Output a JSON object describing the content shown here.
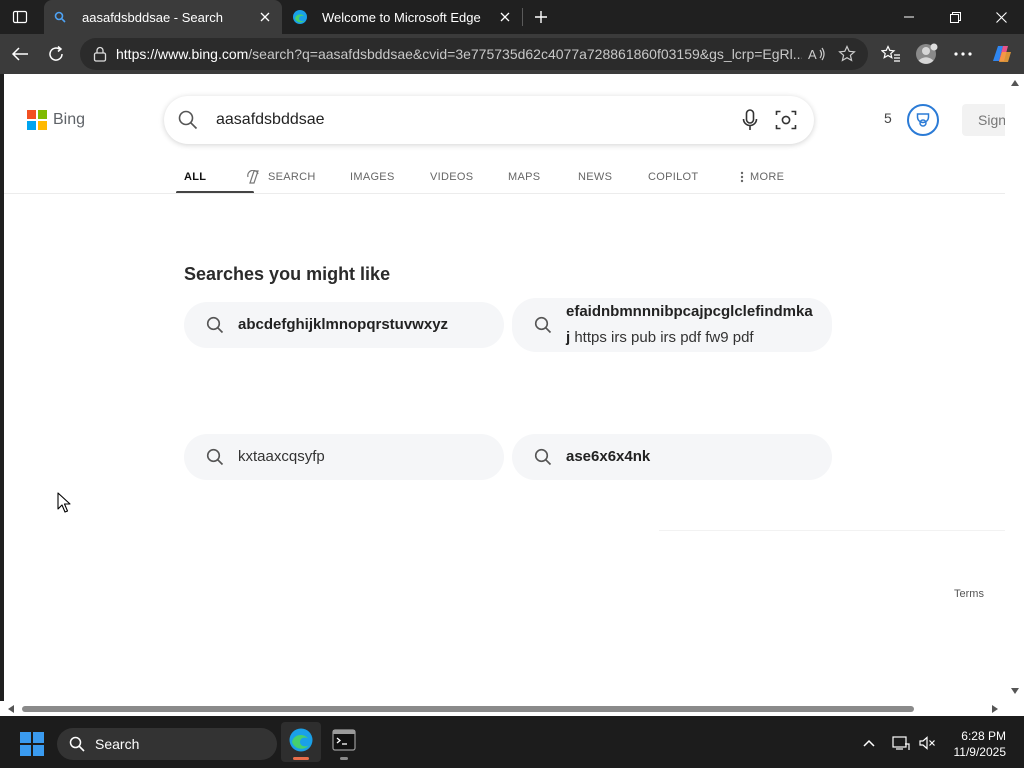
{
  "browser": {
    "tabs": [
      {
        "title": "aasafdsbddsae - Search",
        "active": true
      },
      {
        "title": "Welcome to Microsoft Edge",
        "active": false
      }
    ],
    "url_host": "https://www.bing.com",
    "url_rest": "/search?q=aasafdsbddsae&cvid=3e775735d62c4077a728861860f03159&gs_lcrp=EgRl..."
  },
  "page": {
    "logo_text": "Bing",
    "query": "aasafdsbddsae",
    "rewards_count": "5",
    "signin_label": "Sign in",
    "scopes": [
      "ALL",
      "SEARCH",
      "IMAGES",
      "VIDEOS",
      "MAPS",
      "NEWS",
      "COPILOT",
      "MORE"
    ],
    "related_heading": "Searches you might like",
    "related": [
      {
        "bold": "abcdefghijklmnopqrstuvwxyz",
        "rest": ""
      },
      {
        "bold": "efaidnbmnnnibpcajpcglclefindmkaj",
        "rest": " https irs pub irs pdf fw9 pdf"
      },
      {
        "bold": "",
        "rest": "kxtaaxcqsyfp"
      },
      {
        "bold": "ase6x6x4nk",
        "rest": ""
      }
    ],
    "terms_label": "Terms"
  },
  "taskbar": {
    "search_label": "Search",
    "time": "6:28 PM",
    "date": "11/9/2025"
  },
  "colors": {
    "accent": "#2b7bd6",
    "edge_active_indicator": "#e86d4a",
    "bing_red": "#f25022",
    "bing_green": "#7fba00",
    "bing_blue": "#00a4ef",
    "bing_yellow": "#ffb900"
  }
}
